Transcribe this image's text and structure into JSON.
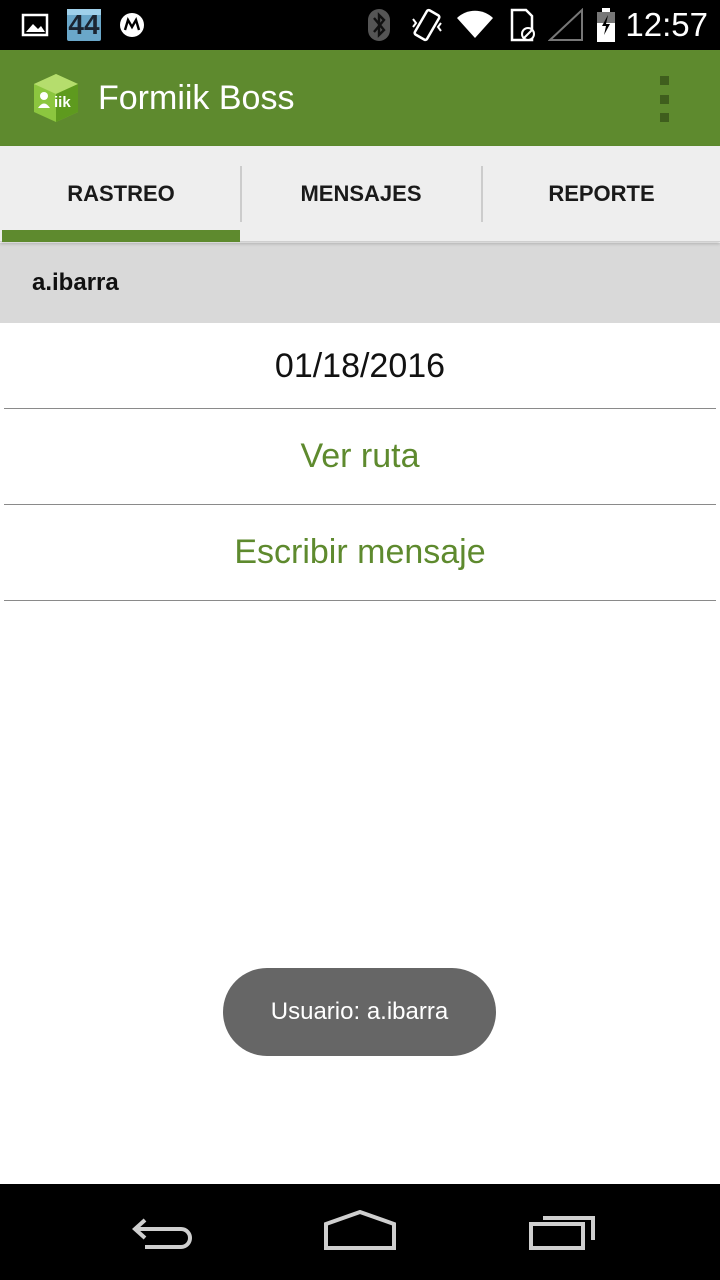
{
  "status_bar": {
    "time": "12:57",
    "notification_badge": "44",
    "icons": [
      "image-icon",
      "badge-44-icon",
      "motorola-icon",
      "bluetooth-icon",
      "vibrate-icon",
      "wifi-icon",
      "sim-icon",
      "signal-icon",
      "battery-icon"
    ]
  },
  "app_bar": {
    "title": "Formiik Boss",
    "logo_text": "iik",
    "menu_icon": "overflow-menu-icon",
    "color": "#5e8a2e"
  },
  "tabs": [
    {
      "label": "RASTREO",
      "selected": true
    },
    {
      "label": "MENSAJES",
      "selected": false
    },
    {
      "label": "REPORTE",
      "selected": false
    }
  ],
  "user_header": {
    "username": "a.ibarra"
  },
  "content": {
    "date": "01/18/2016",
    "view_route": "Ver ruta",
    "write_message": "Escribir mensaje"
  },
  "toast": {
    "text": "Usuario: a.ibarra"
  },
  "nav_bar": {
    "icons": [
      "back-icon",
      "home-icon",
      "recent-apps-icon"
    ]
  }
}
